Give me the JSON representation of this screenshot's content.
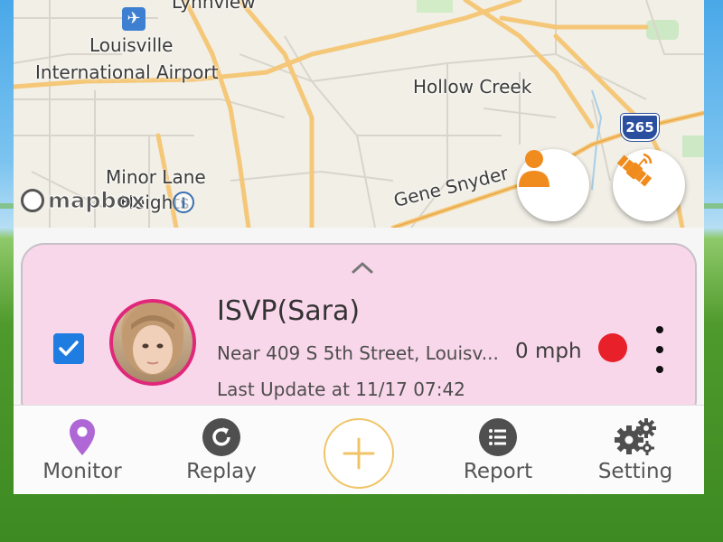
{
  "map": {
    "labels": {
      "lynnview": "Lynnview",
      "louisville": "Louisville",
      "airport": "International Airport",
      "hollow_creek": "Hollow Creek",
      "minor_lane": "Minor Lane",
      "heights": "Heights",
      "gene_snyder": "Gene Snyder",
      "highway_shield": "265"
    },
    "attribution": "mapbox",
    "info_symbol": "i"
  },
  "device": {
    "name": "ISVP(Sara)",
    "address": "Near 409 S 5th Street, Louisv...",
    "speed": "0 mph",
    "last_update": "Last Update at 11/17 07:42",
    "selected": true,
    "status_color": "#e8202a"
  },
  "bottom_nav": {
    "monitor": "Monitor",
    "replay": "Replay",
    "report": "Report",
    "setting": "Setting"
  },
  "colors": {
    "accent_orange": "#f08c1e",
    "card_pink": "#f9d7ea",
    "monitor_purple": "#b067d6",
    "checkbox_blue": "#1f7ce0",
    "add_ring": "#f0c466"
  },
  "icons": {
    "person_button": "person-icon",
    "satellite_button": "satellite-icon",
    "monitor": "location-pin-icon",
    "replay": "replay-icon",
    "add": "plus-icon",
    "report": "list-icon",
    "setting": "gears-icon",
    "more": "more-vertical-icon"
  }
}
